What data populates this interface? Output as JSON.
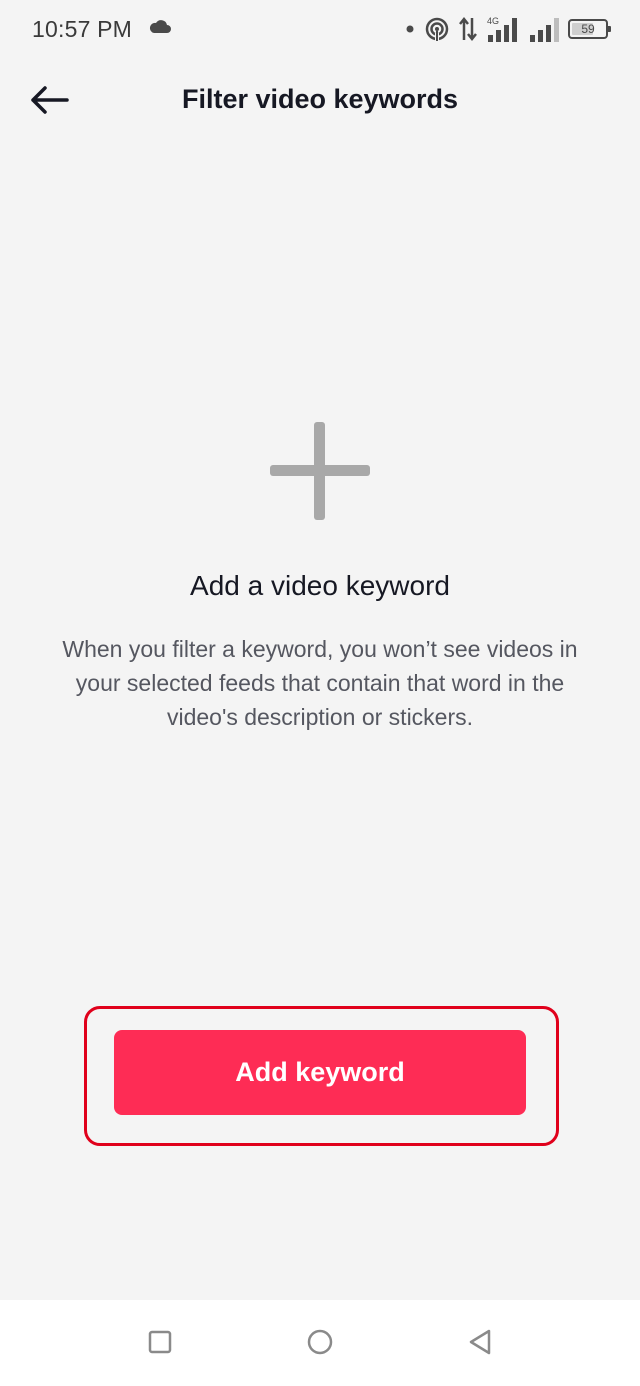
{
  "status_bar": {
    "time": "10:57 PM",
    "battery_percent": "59",
    "icons": [
      "cloud-icon",
      "dot-icon",
      "hotspot-icon",
      "data-arrows-icon",
      "signal-4g-icon",
      "signal-icon",
      "battery-icon"
    ],
    "network_label": "4G"
  },
  "header": {
    "title": "Filter video keywords",
    "back_icon": "arrow-left-icon"
  },
  "empty_state": {
    "icon": "plus-icon",
    "title": "Add a video keyword",
    "description": "When you filter a keyword, you won’t see videos in your selected feeds that contain that word in the video's description or stickers."
  },
  "cta": {
    "label": "Add keyword",
    "color": "#fe2c55",
    "highlight_color": "#e0001b"
  },
  "nav_bar": {
    "icons": [
      "recents-square-icon",
      "home-circle-icon",
      "back-triangle-icon"
    ]
  }
}
